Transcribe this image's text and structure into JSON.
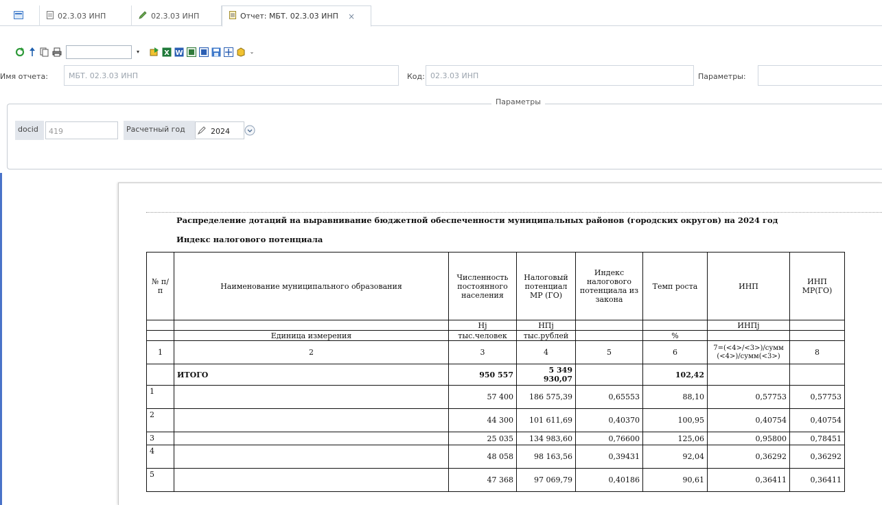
{
  "tabs": [
    {
      "label": "",
      "icon": "grid-icon"
    },
    {
      "label": "02.3.03 ИНП",
      "icon": "document-icon"
    },
    {
      "label": "02.3.03 ИНП",
      "icon": "pencil-icon"
    },
    {
      "label": "Отчет: МБТ. 02.3.03 ИНП",
      "icon": "report-icon",
      "close": "×"
    }
  ],
  "header": {
    "report_name_label": "Имя отчета:",
    "report_name_value": "МБТ. 02.3.03 ИНП",
    "code_label": "Код:",
    "code_value": "02.3.03 ИНП",
    "params_label": "Параметры:",
    "params_value": ""
  },
  "parameters": {
    "title": "Параметры",
    "docid_label": "docid",
    "docid_value": "419",
    "year_label": "Расчетный год",
    "year_value": "2024"
  },
  "report": {
    "title": "Распределение дотаций на выравнивание бюджетной обеспеченности муниципальных районов (городских округов) на 2024 год",
    "subtitle": "Индекс налогового потенциала",
    "headers": [
      "№ п/п",
      "Наименование муниципального образования",
      "Численность постоянного населения",
      "Налоговый потенциал МР (ГО)",
      "Индекс налогового потенциала из закона",
      "Темп роста",
      "ИНП",
      "ИНП МР(ГО)"
    ],
    "symbols": [
      "",
      "",
      "Hj",
      "НПj",
      "",
      "",
      "ИНПj",
      ""
    ],
    "units_label": "Единица измерения",
    "units": [
      "",
      "",
      "тыс.человек",
      "тыс.рублей",
      "",
      "%",
      "",
      ""
    ],
    "col_numbers": [
      "1",
      "2",
      "3",
      "4",
      "5",
      "6",
      "7=(<4>/<3>)/сумм (<4>)/сумм(<3>)",
      "8"
    ],
    "total": {
      "label": "ИТОГО",
      "population": "950 557",
      "potential": "5 349 930,07",
      "growth": "102,42"
    },
    "rows": [
      {
        "n": "1",
        "name": "",
        "population": "57 400",
        "potential": "186 575,39",
        "index_law": "0,65553",
        "growth": "88,10",
        "inp": "0,57753",
        "inp_mr": "0,57753"
      },
      {
        "n": "2",
        "name": "",
        "population": "44 300",
        "potential": "101 611,69",
        "index_law": "0,40370",
        "growth": "100,95",
        "inp": "0,40754",
        "inp_mr": "0,40754"
      },
      {
        "n": "3",
        "name": "",
        "population": "25 035",
        "potential": "134 983,60",
        "index_law": "0,76600",
        "growth": "125,06",
        "inp": "0,95800",
        "inp_mr": "0,78451"
      },
      {
        "n": "4",
        "name": "",
        "population": "48 058",
        "potential": "98 163,56",
        "index_law": "0,39431",
        "growth": "92,04",
        "inp": "0,36292",
        "inp_mr": "0,36292"
      },
      {
        "n": "5",
        "name": "",
        "population": "47 368",
        "potential": "97 069,79",
        "index_law": "0,40186",
        "growth": "90,61",
        "inp": "0,36411",
        "inp_mr": "0,36411"
      }
    ]
  }
}
